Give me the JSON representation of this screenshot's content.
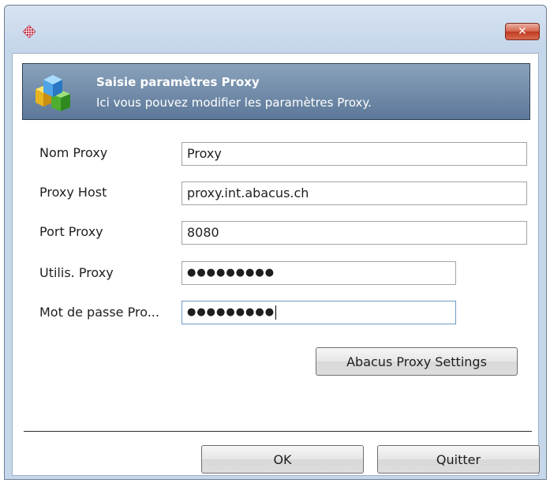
{
  "window": {
    "close_label": "✕"
  },
  "header": {
    "title": "Saisie paramètres Proxy",
    "subtitle": "Ici vous pouvez modifier les paramètres Proxy."
  },
  "form": {
    "name_label": "Nom Proxy",
    "name_value": "Proxy",
    "host_label": "Proxy Host",
    "host_value": "proxy.int.abacus.ch",
    "port_label": "Port Proxy",
    "port_value": "8080",
    "user_label": "Utilis. Proxy",
    "user_value": "●●●●●●●●●",
    "password_label": "Mot de passe Pro...",
    "password_value": "●●●●●●●●●"
  },
  "buttons": {
    "settings_label": "Abacus Proxy Settings",
    "ok_label": "OK",
    "quit_label": "Quitter"
  }
}
